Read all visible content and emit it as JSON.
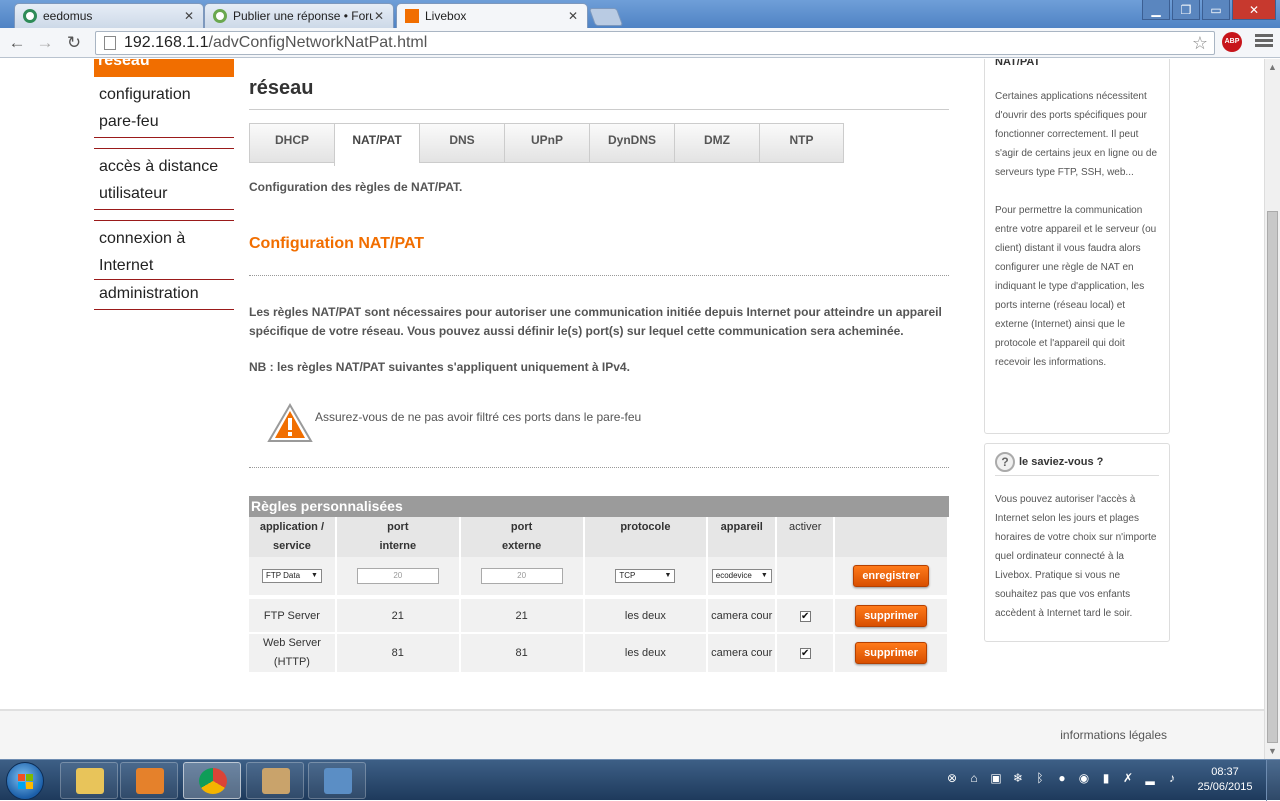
{
  "browser": {
    "tabs": [
      {
        "label": "eedomus",
        "active": false,
        "color": "#2e8b57"
      },
      {
        "label": "Publier une réponse • Foru",
        "active": false,
        "color": "#6aa84f"
      },
      {
        "label": "Livebox",
        "active": true,
        "color": "#f16e00"
      }
    ],
    "url_host": "192.168.1.1",
    "url_path": "/advConfigNetworkNatPat.html",
    "adblock_label": "ABP"
  },
  "leftnav": {
    "active": "réseau",
    "groups": [
      [
        "configuration",
        "pare-feu"
      ],
      [
        "accès à distance",
        "utilisateur"
      ],
      [
        "connexion à",
        "Internet",
        "administration"
      ]
    ]
  },
  "main": {
    "title": "réseau",
    "tabs": [
      "DHCP",
      "NAT/PAT",
      "DNS",
      "UPnP",
      "DynDNS",
      "DMZ",
      "NTP"
    ],
    "active_tab": "NAT/PAT",
    "intro": "Configuration des règles de NAT/PAT.",
    "section_title": "Configuration NAT/PAT",
    "desc": "Les règles NAT/PAT sont nécessaires pour autoriser une communication initiée depuis Internet pour atteindre un appareil spécifique de votre réseau. Vous pouvez aussi définir le(s) port(s) sur lequel cette communication sera acheminée.",
    "nb": "NB : les règles NAT/PAT suivantes s'appliquent uniquement à IPv4.",
    "warning": "Assurez-vous de ne pas avoir filtré ces ports dans le pare-feu"
  },
  "rules": {
    "title": "Règles personnalisées",
    "headers": {
      "service_1": "application /",
      "service_2": "service",
      "internal_1": "port",
      "internal_2": "interne",
      "external_1": "port",
      "external_2": "externe",
      "protocol": "protocole",
      "device": "appareil",
      "enable": "activer"
    },
    "new_rule": {
      "service": "FTP Data",
      "internal_placeholder": "20",
      "external_placeholder": "20",
      "protocol": "TCP",
      "device": "ecodevice",
      "button": "enregistrer"
    },
    "rows": [
      {
        "service": "FTP Server",
        "service_2": "",
        "internal": "21",
        "external": "21",
        "protocol": "les deux",
        "device": "camera cour",
        "enabled": "✔",
        "button": "supprimer"
      },
      {
        "service": "Web Server",
        "service_2": "(HTTP)",
        "internal": "81",
        "external": "81",
        "protocol": "les deux",
        "device": "camera cour",
        "enabled": "✔",
        "button": "supprimer"
      }
    ]
  },
  "help": {
    "title": "NAT/PAT",
    "p1": "Certaines applications nécessitent d'ouvrir des ports spécifiques pour fonctionner correctement. Il peut s'agir de certains jeux en ligne ou de serveurs type FTP, SSH, web...",
    "p2": "Pour permettre la communication entre votre appareil et le serveur (ou client) distant il vous faudra alors configurer une règle de NAT en indiquant le type d'application, les ports interne (réseau local) et externe (Internet) ainsi que le protocole et l'appareil qui doit recevoir les informations."
  },
  "tip": {
    "title": "le saviez-vous ?",
    "text": "Vous pouvez autoriser l'accès à Internet selon les jours et plages horaires de votre choix sur n'importe quel ordinateur connecté à la Livebox. Pratique si vous ne souhaitez pas que vos enfants accèdent à Internet tard le soir."
  },
  "footer": {
    "legal": "informations légales"
  },
  "taskbar": {
    "time": "08:37",
    "date": "25/06/2015"
  },
  "colors": {
    "brand": "#f16e00"
  }
}
